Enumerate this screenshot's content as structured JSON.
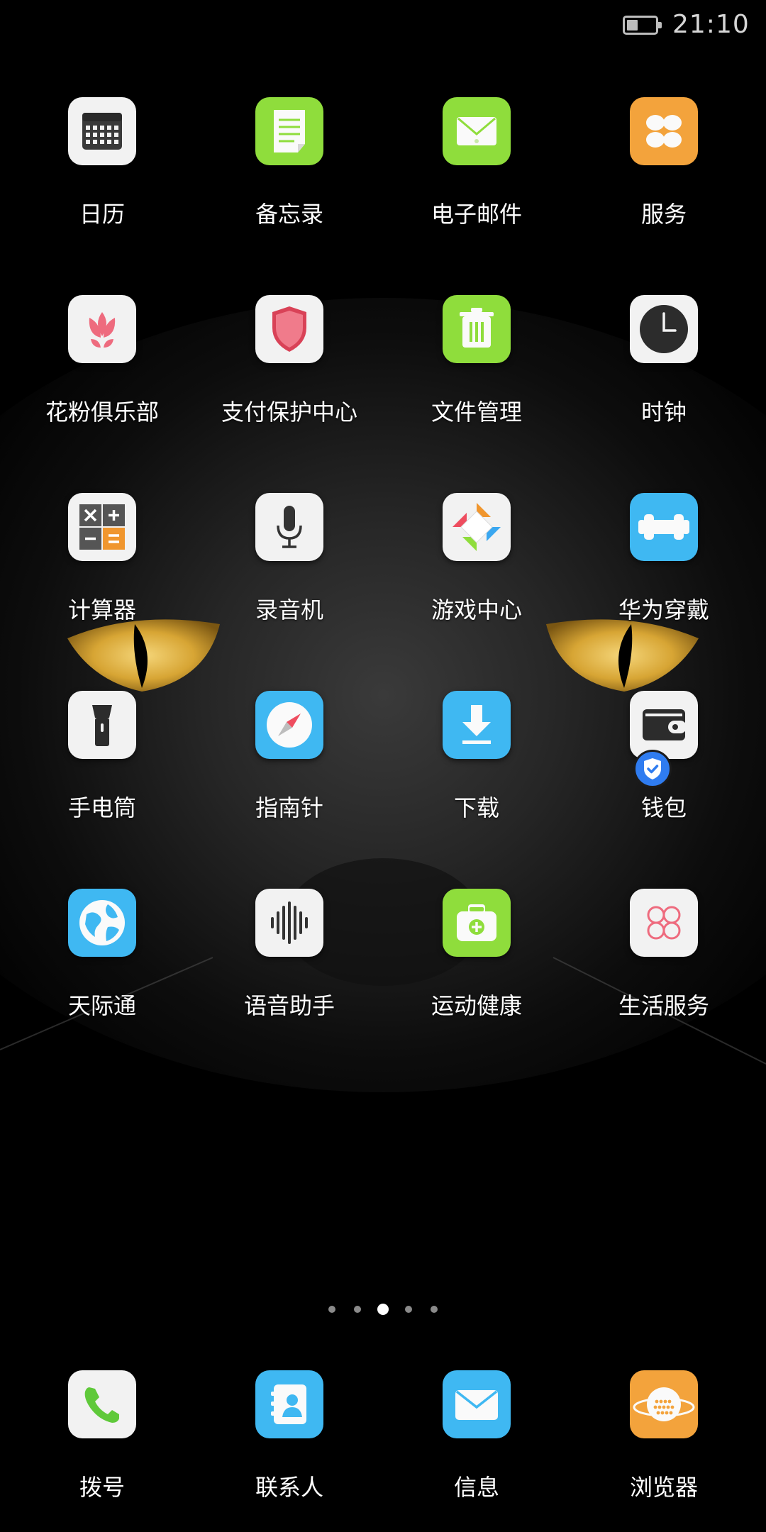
{
  "status_bar": {
    "time": "21:10",
    "battery_level": 0.4
  },
  "apps": [
    {
      "label": "日历",
      "icon": "calendar-icon",
      "bg": "#f2f2f2"
    },
    {
      "label": "备忘录",
      "icon": "notes-icon",
      "bg": "#8fdd3c"
    },
    {
      "label": "电子邮件",
      "icon": "email-icon",
      "bg": "#8fdd3c"
    },
    {
      "label": "服务",
      "icon": "services-icon",
      "bg": "#f3a33c"
    },
    {
      "label": "花粉俱乐部",
      "icon": "huafen-club-icon",
      "bg": "#f2f2f2"
    },
    {
      "label": "支付保护中心",
      "icon": "payment-shield-icon",
      "bg": "#f2f2f2"
    },
    {
      "label": "文件管理",
      "icon": "file-manager-icon",
      "bg": "#8fdd3c"
    },
    {
      "label": "时钟",
      "icon": "clock-icon",
      "bg": "#f2f2f2"
    },
    {
      "label": "计算器",
      "icon": "calculator-icon",
      "bg": "#f2f2f2"
    },
    {
      "label": "录音机",
      "icon": "microphone-icon",
      "bg": "#f2f2f2"
    },
    {
      "label": "游戏中心",
      "icon": "game-center-icon",
      "bg": "#f2f2f2"
    },
    {
      "label": "华为穿戴",
      "icon": "huawei-wear-icon",
      "bg": "#3fb8f2"
    },
    {
      "label": "手电筒",
      "icon": "flashlight-icon",
      "bg": "#f2f2f2"
    },
    {
      "label": "指南针",
      "icon": "compass-icon",
      "bg": "#3fb8f2"
    },
    {
      "label": "下载",
      "icon": "download-icon",
      "bg": "#3fb8f2"
    },
    {
      "label": "钱包",
      "icon": "wallet-icon",
      "bg": "#f2f2f2"
    },
    {
      "label": "天际通",
      "icon": "globe-icon",
      "bg": "#3fb8f2"
    },
    {
      "label": "语音助手",
      "icon": "voice-assistant-icon",
      "bg": "#f2f2f2"
    },
    {
      "label": "运动健康",
      "icon": "health-icon",
      "bg": "#8fdd3c"
    },
    {
      "label": "生活服务",
      "icon": "life-services-icon",
      "bg": "#f2f2f2"
    }
  ],
  "dock": [
    {
      "label": "拨号",
      "icon": "phone-icon",
      "bg": "#f2f2f2"
    },
    {
      "label": "联系人",
      "icon": "contacts-icon",
      "bg": "#3fb8f2"
    },
    {
      "label": "信息",
      "icon": "messages-icon",
      "bg": "#3fb8f2"
    },
    {
      "label": "浏览器",
      "icon": "browser-icon",
      "bg": "#f3a33c"
    }
  ],
  "wallet_badge": "shield-check-icon",
  "page_indicator": {
    "count": 5,
    "active_index": 2,
    "first_is_hint": true
  }
}
